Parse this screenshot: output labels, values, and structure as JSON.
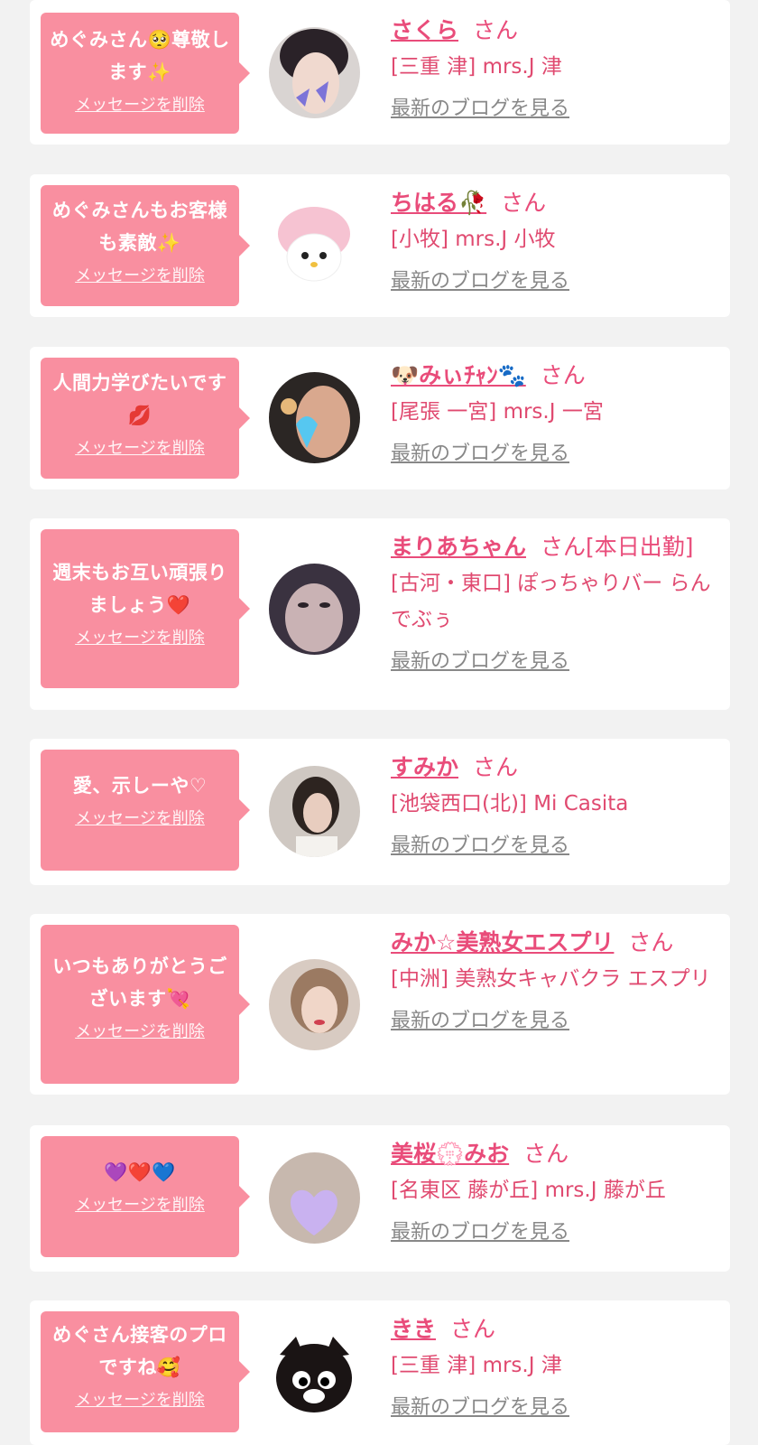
{
  "cards": [
    {
      "message": "めぐみさん🥺尊敬します✨",
      "delete_label": "メッセージを削除",
      "name": "さくら",
      "honorific": "さん",
      "shop": "[三重 津] mrs.J 津",
      "blog_link": "最新のブログを見る"
    },
    {
      "message": "めぐみさんもお客様も素敵✨",
      "delete_label": "メッセージを削除",
      "name": "ちはる🥀",
      "honorific": "さん",
      "shop": "[小牧] mrs.J 小牧",
      "blog_link": "最新のブログを見る"
    },
    {
      "message": "人間力学びたいです💋",
      "delete_label": "メッセージを削除",
      "name": "🐶みぃﾁｬﾝ🐾",
      "honorific": "さん",
      "shop": "[尾張 一宮] mrs.J 一宮",
      "blog_link": "最新のブログを見る"
    },
    {
      "message": "週末もお互い頑張りましょう❤️",
      "delete_label": "メッセージを削除",
      "name": "まりあちゃん",
      "honorific": "さん[本日出勤]",
      "shop": "[古河・東口] ぽっちゃりバー らんでぶぅ",
      "blog_link": "最新のブログを見る"
    },
    {
      "message": "愛、示しーや♡",
      "delete_label": "メッセージを削除",
      "name": "すみか",
      "honorific": "さん",
      "shop": "[池袋西口(北)] Mi Casita",
      "blog_link": "最新のブログを見る"
    },
    {
      "message": "いつもありがとうございます💘",
      "delete_label": "メッセージを削除",
      "name": "みか☆美熟女エスプリ",
      "honorific": "さん",
      "shop": "[中洲] 美熟女キャバクラ エスプリ",
      "blog_link": "最新のブログを見る"
    },
    {
      "message": "💜❤️💙",
      "delete_label": "メッセージを削除",
      "name": "美桜💮みお",
      "honorific": "さん",
      "shop": "[名東区 藤が丘] mrs.J 藤が丘",
      "blog_link": "最新のブログを見る"
    },
    {
      "message": "めぐさん接客のプロですね🥰",
      "delete_label": "メッセージを削除",
      "name": "きき",
      "honorific": "さん",
      "shop": "[三重 津] mrs.J 津",
      "blog_link": "最新のブログを見る"
    }
  ],
  "colors": {
    "bubble": "#f98fa0",
    "accent": "#e94c7a",
    "link_gray": "#888888",
    "background": "#f2f2f2"
  }
}
